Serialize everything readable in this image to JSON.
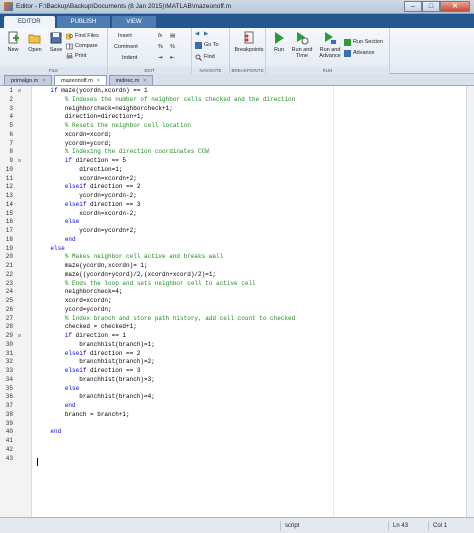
{
  "window": {
    "title": "Editor - F:\\Backup\\Backup\\Documents (8 Jan 2015)\\MATLAB\\mazeonoff.m",
    "minimize": "–",
    "maximize": "□",
    "close": "✕"
  },
  "ribbon_tabs": [
    "EDITOR",
    "PUBLISH",
    "VIEW"
  ],
  "toolstrip": {
    "file_group": "FILE",
    "new": "New",
    "open": "Open",
    "save": "Save",
    "find_files": "Find Files",
    "compare": "Compare",
    "print": "Print",
    "edit_group": "EDIT",
    "insert": "Insert",
    "comment": "Comment",
    "indent": "Indent",
    "navigate_group": "NAVIGATE",
    "go_to": "Go To",
    "find": "Find",
    "breakpoints_group": "BREAKPOINTS",
    "breakpoints": "Breakpoints",
    "run_group": "RUN",
    "run": "Run",
    "run_and_time": "Run and Time",
    "run_and_advance": "Run and Advance",
    "run_section": "Run Section",
    "advance": "Advance"
  },
  "file_tabs": [
    {
      "label": "primalgo.m"
    },
    {
      "label": "mazeonoff.m"
    },
    {
      "label": "inidirec.m"
    }
  ],
  "code_lines": [
    {
      "n": "1",
      "fold": "⊟",
      "indent": 4,
      "parts": [
        [
          "kw",
          "if"
        ],
        [
          "tx",
          " maze(ycordn,xcordn) == 1"
        ]
      ]
    },
    {
      "n": "2",
      "fold": "",
      "indent": 8,
      "parts": [
        [
          "cm",
          "% Indexes the number of neighbor cells checked and the direction"
        ]
      ]
    },
    {
      "n": "3",
      "fold": "",
      "indent": 8,
      "parts": [
        [
          "tx",
          "neighborcheck=neighborcheck+1;"
        ]
      ]
    },
    {
      "n": "4",
      "fold": "",
      "indent": 8,
      "parts": [
        [
          "tx",
          "direction=direction+1;"
        ]
      ]
    },
    {
      "n": "5",
      "fold": "",
      "indent": 8,
      "parts": [
        [
          "cm",
          "% Resets the neighbor cell location"
        ]
      ]
    },
    {
      "n": "6",
      "fold": "",
      "indent": 8,
      "parts": [
        [
          "tx",
          "xcordn=xcord;"
        ]
      ]
    },
    {
      "n": "7",
      "fold": "",
      "indent": 8,
      "parts": [
        [
          "tx",
          "ycordn=ycord;"
        ]
      ]
    },
    {
      "n": "8",
      "fold": "",
      "indent": 8,
      "parts": [
        [
          "cm",
          "% Indexing the direction coordinates CCW"
        ]
      ]
    },
    {
      "n": "9",
      "fold": "⊟",
      "indent": 8,
      "parts": [
        [
          "kw",
          "if"
        ],
        [
          "tx",
          " direction == 5"
        ]
      ]
    },
    {
      "n": "10",
      "fold": "",
      "indent": 12,
      "parts": [
        [
          "tx",
          "direction=1;"
        ]
      ]
    },
    {
      "n": "11",
      "fold": "",
      "indent": 12,
      "parts": [
        [
          "tx",
          "xcordn=xcordn+2;"
        ]
      ]
    },
    {
      "n": "12",
      "fold": "",
      "indent": 8,
      "parts": [
        [
          "kw",
          "elseif"
        ],
        [
          "tx",
          " direction == 2"
        ]
      ]
    },
    {
      "n": "13",
      "fold": "",
      "indent": 12,
      "parts": [
        [
          "tx",
          "ycordn=ycordn-2;"
        ]
      ]
    },
    {
      "n": "14",
      "fold": "",
      "indent": 8,
      "parts": [
        [
          "kw",
          "elseif"
        ],
        [
          "tx",
          " direction == 3"
        ]
      ]
    },
    {
      "n": "15",
      "fold": "",
      "indent": 12,
      "parts": [
        [
          "tx",
          "xcordn=xcordn-2;"
        ]
      ]
    },
    {
      "n": "16",
      "fold": "",
      "indent": 8,
      "parts": [
        [
          "kw",
          "else"
        ]
      ]
    },
    {
      "n": "17",
      "fold": "",
      "indent": 12,
      "parts": [
        [
          "tx",
          "ycordn=ycordn+2;"
        ]
      ]
    },
    {
      "n": "18",
      "fold": "",
      "indent": 8,
      "parts": [
        [
          "kw",
          "end"
        ]
      ]
    },
    {
      "n": "19",
      "fold": "",
      "indent": 4,
      "parts": [
        [
          "kw",
          "else"
        ]
      ]
    },
    {
      "n": "20",
      "fold": "",
      "indent": 8,
      "parts": [
        [
          "cm",
          "% Makes neighbor cell active and breaks wall"
        ]
      ]
    },
    {
      "n": "21",
      "fold": "",
      "indent": 8,
      "parts": [
        [
          "tx",
          "maze(ycordn,xcordn)= 1;"
        ]
      ]
    },
    {
      "n": "22",
      "fold": "",
      "indent": 8,
      "parts": [
        [
          "tx",
          "maze((ycordn+ycord)/2,(xcordn+xcord)/2)=1;"
        ]
      ]
    },
    {
      "n": "23",
      "fold": "",
      "indent": 8,
      "parts": [
        [
          "cm",
          "% Ends the loop and sets neighbor cell to active cell"
        ]
      ]
    },
    {
      "n": "24",
      "fold": "",
      "indent": 8,
      "parts": [
        [
          "tx",
          "neighborcheck=4;"
        ]
      ]
    },
    {
      "n": "25",
      "fold": "",
      "indent": 8,
      "parts": [
        [
          "tx",
          "xcord=xcordn;"
        ]
      ]
    },
    {
      "n": "26",
      "fold": "",
      "indent": 8,
      "parts": [
        [
          "tx",
          "ycord=ycordn;"
        ]
      ]
    },
    {
      "n": "27",
      "fold": "",
      "indent": 8,
      "parts": [
        [
          "cm",
          "% Index branch and store path history, add cell count to checked"
        ]
      ]
    },
    {
      "n": "28",
      "fold": "",
      "indent": 8,
      "parts": [
        [
          "tx",
          "checked = checked+1;"
        ]
      ]
    },
    {
      "n": "29",
      "fold": "⊟",
      "indent": 8,
      "parts": [
        [
          "kw",
          "if"
        ],
        [
          "tx",
          " direction == 1"
        ]
      ]
    },
    {
      "n": "30",
      "fold": "",
      "indent": 12,
      "parts": [
        [
          "tx",
          "branchhist(branch)=1;"
        ]
      ]
    },
    {
      "n": "31",
      "fold": "",
      "indent": 8,
      "parts": [
        [
          "kw",
          "elseif"
        ],
        [
          "tx",
          " direction == 2"
        ]
      ]
    },
    {
      "n": "32",
      "fold": "",
      "indent": 12,
      "parts": [
        [
          "tx",
          "branchhist(branch)=2;"
        ]
      ]
    },
    {
      "n": "33",
      "fold": "",
      "indent": 8,
      "parts": [
        [
          "kw",
          "elseif"
        ],
        [
          "tx",
          " direction == 3"
        ]
      ]
    },
    {
      "n": "34",
      "fold": "",
      "indent": 12,
      "parts": [
        [
          "tx",
          "branchhist(branch)=3;"
        ]
      ]
    },
    {
      "n": "35",
      "fold": "",
      "indent": 8,
      "parts": [
        [
          "kw",
          "else"
        ]
      ]
    },
    {
      "n": "36",
      "fold": "",
      "indent": 12,
      "parts": [
        [
          "tx",
          "branchhist(branch)=4;"
        ]
      ]
    },
    {
      "n": "37",
      "fold": "",
      "indent": 8,
      "parts": [
        [
          "kw",
          "end"
        ]
      ]
    },
    {
      "n": "38",
      "fold": "",
      "indent": 8,
      "parts": [
        [
          "tx",
          "branch = branch+1;"
        ]
      ]
    },
    {
      "n": "39",
      "fold": "",
      "indent": 0,
      "parts": []
    },
    {
      "n": "40",
      "fold": "",
      "indent": 4,
      "parts": [
        [
          "kw",
          "end"
        ]
      ]
    },
    {
      "n": "41",
      "fold": "",
      "indent": 0,
      "parts": []
    },
    {
      "n": "42",
      "fold": "",
      "indent": 0,
      "parts": []
    },
    {
      "n": "43",
      "fold": "",
      "indent": 0,
      "parts": []
    }
  ],
  "status": {
    "mode": "script",
    "ln_label": "Ln",
    "ln_value": "43",
    "col_label": "Col",
    "col_value": "1"
  },
  "colors": {
    "keyword": "#0000ff",
    "comment": "#228b22",
    "ribbon": "#24578f"
  }
}
